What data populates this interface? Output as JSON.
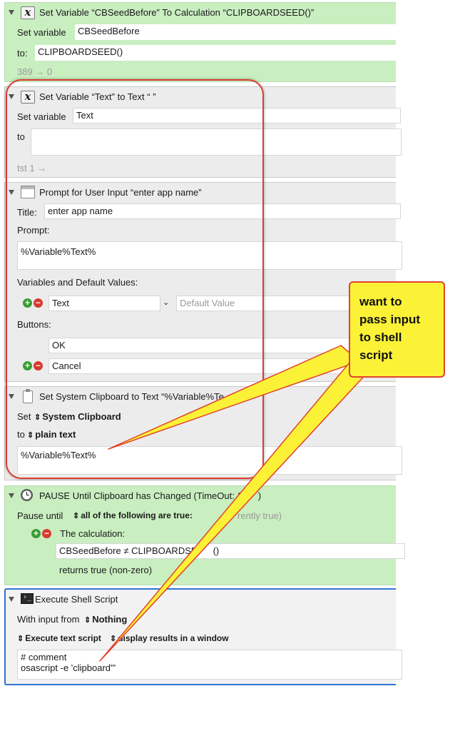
{
  "actions": {
    "set_var_cbseed": {
      "title": "Set Variable “CBSeedBefore” To Calculation “CLIPBOARDSEED()”",
      "set_variable_label": "Set variable",
      "variable_name": "CBSeedBefore",
      "to_label": "to:",
      "calculation": "CLIPBOARDSEED()",
      "result": "389 → 0"
    },
    "set_var_text": {
      "title": "Set Variable “Text” to Text “ ”",
      "set_variable_label": "Set variable",
      "variable_name": "Text",
      "to_label": "to",
      "to_value": "",
      "result": "tst 1 →"
    },
    "prompt": {
      "title": "Prompt for User Input “enter app name”",
      "title_label": "Title:",
      "title_value": "enter app name",
      "prompt_label": "Prompt:",
      "prompt_value": "%Variable%Text%",
      "variables_label": "Variables and Default Values:",
      "variable_name": "Text",
      "default_placeholder": "Default Value",
      "buttons_label": "Buttons:",
      "button_ok": "OK",
      "button_cancel": "Cancel"
    },
    "set_clipboard": {
      "title": "Set System Clipboard to Text “%Variable%Te",
      "set_label": "Set",
      "clipboard_option": "System Clipboard",
      "to_label": "to",
      "format_option": "plain text",
      "text_value": "%Variable%Text%"
    },
    "pause": {
      "title": "PAUSE Until Clipboard has Changed (TimeOut: 1",
      "title_tail": ")",
      "pause_until_label": "Pause until",
      "condition_option": "all of the following are true:",
      "condition_hint": "rently true)",
      "calc_label": "The calculation:",
      "calc_value": "CBSeedBefore ≠ CLIPBOARDSE",
      "calc_tail": "()",
      "returns": "returns true (non-zero)"
    },
    "shell": {
      "title": "Execute Shell Script",
      "input_label": "With input from",
      "input_option": "Nothing",
      "exec_option": "Execute text script",
      "display_option": "display results in a window",
      "script_line1": "# comment",
      "script_line2": "osascript -e 'clipboard'\""
    }
  },
  "callout": {
    "line1": "want to",
    "line2": "pass input",
    "line3": "to shell",
    "line4": "script"
  },
  "colors": {
    "green_action": "#c9eec0",
    "highlight_frame": "#dd3b32",
    "callout_fill": "#fbf237",
    "selection_blue": "#2f74d0"
  }
}
